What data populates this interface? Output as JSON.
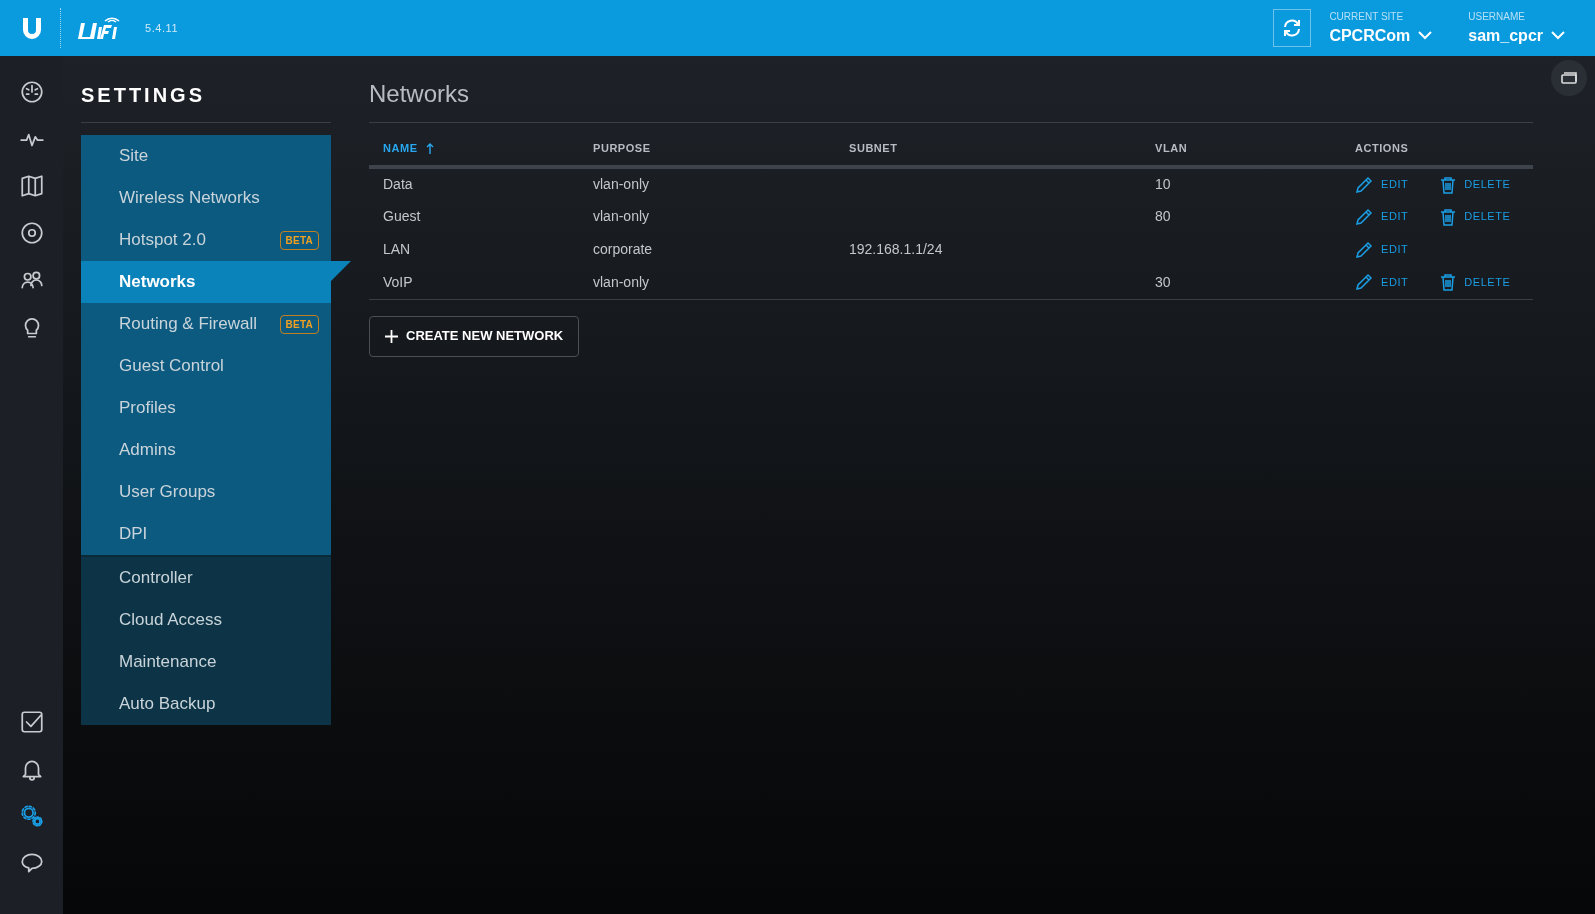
{
  "header": {
    "version": "5.4.11",
    "current_site": {
      "label": "CURRENT SITE",
      "value": "CPCRCom"
    },
    "username": {
      "label": "USERNAME",
      "value": "sam_cpcr"
    }
  },
  "nav_icons": [
    {
      "kind": "dashboard",
      "selected": false
    },
    {
      "kind": "statistics",
      "selected": false
    },
    {
      "kind": "map",
      "selected": false
    },
    {
      "kind": "devices",
      "selected": false
    },
    {
      "kind": "clients",
      "selected": false
    },
    {
      "kind": "insights",
      "selected": false
    },
    {
      "kind": "events",
      "selected": false
    },
    {
      "kind": "alerts",
      "selected": false
    },
    {
      "kind": "settings",
      "selected": true
    },
    {
      "kind": "chat",
      "selected": false
    }
  ],
  "settings": {
    "title": "SETTINGS",
    "groups": [
      {
        "items": [
          {
            "label": "Site",
            "selected": false
          },
          {
            "label": "Wireless Networks",
            "selected": false
          },
          {
            "label": "Hotspot 2.0",
            "selected": false,
            "badge": "BETA"
          },
          {
            "label": "Networks",
            "selected": true
          },
          {
            "label": "Routing & Firewall",
            "selected": false,
            "badge": "BETA"
          },
          {
            "label": "Guest Control",
            "selected": false
          },
          {
            "label": "Profiles",
            "selected": false
          },
          {
            "label": "Admins",
            "selected": false
          },
          {
            "label": "User Groups",
            "selected": false
          },
          {
            "label": "DPI",
            "selected": false
          }
        ]
      },
      {
        "items": [
          {
            "label": "Controller",
            "selected": false
          },
          {
            "label": "Cloud Access",
            "selected": false
          },
          {
            "label": "Maintenance",
            "selected": false
          },
          {
            "label": "Auto Backup",
            "selected": false
          }
        ]
      }
    ]
  },
  "page_title": "Networks",
  "table": {
    "columns": [
      {
        "label": "NAME",
        "sorted": true
      },
      {
        "label": "PURPOSE",
        "sorted": false
      },
      {
        "label": "SUBNET",
        "sorted": false
      },
      {
        "label": "VLAN",
        "sorted": false
      },
      {
        "label": "ACTIONS",
        "sorted": false
      }
    ],
    "rows": [
      {
        "cells": [
          "Data",
          "vlan-only",
          "",
          "10"
        ],
        "actions": [
          {
            "kind": "edit",
            "label": "EDIT"
          },
          {
            "kind": "delete",
            "label": "DELETE"
          }
        ]
      },
      {
        "cells": [
          "Guest",
          "vlan-only",
          "",
          "80"
        ],
        "actions": [
          {
            "kind": "edit",
            "label": "EDIT"
          },
          {
            "kind": "delete",
            "label": "DELETE"
          }
        ]
      },
      {
        "cells": [
          "LAN",
          "corporate",
          "192.168.1.1/24",
          ""
        ],
        "actions": [
          {
            "kind": "edit",
            "label": "EDIT"
          }
        ]
      },
      {
        "cells": [
          "VoIP",
          "vlan-only",
          "",
          "30"
        ],
        "actions": [
          {
            "kind": "edit",
            "label": "EDIT"
          },
          {
            "kind": "delete",
            "label": "DELETE"
          }
        ]
      }
    ]
  },
  "create_button": "CREATE NEW NETWORK"
}
